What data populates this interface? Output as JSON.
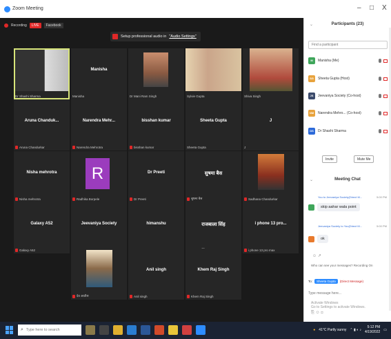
{
  "window": {
    "title": "Zoom Meeting",
    "minimize": "–",
    "maximize": "□",
    "close": "X"
  },
  "recording": {
    "label": "Recording",
    "live": "LIVE",
    "platform": "Facebook"
  },
  "audio_tip": {
    "text": "Setup professional audio in ",
    "link": "\"Audio Settings\""
  },
  "tiles": [
    {
      "label": "Dr Shashi Sharma",
      "mute": false
    },
    {
      "name": "Manisha",
      "label": "Manisha",
      "mute": false
    },
    {
      "label": "Dr Mani Ram Singh",
      "mute": false
    },
    {
      "label": "Sylvie Gupta",
      "mute": false
    },
    {
      "label": "Shiva Singh",
      "mute": false
    },
    {
      "name": "Aruna Chanduk...",
      "label": "Aruna Chandurkar",
      "mute": true
    },
    {
      "name": "Narendra Mehr...",
      "label": "Narendra Mehrotra",
      "mute": true
    },
    {
      "name": "bisshan kumar",
      "label": "bisshan kumar",
      "mute": true
    },
    {
      "name": "Sheeta Gupta",
      "label": "Sheeta Gupta",
      "mute": false
    },
    {
      "name": "J",
      "label": "J",
      "mute": false
    },
    {
      "name": "Nisha mehrotra",
      "label": "Nisha mehrotra",
      "mute": true
    },
    {
      "label": "Radhika Borpele",
      "avatar": "R",
      "mute": true
    },
    {
      "name": "Dr Preeti",
      "label": "Dr Preeti",
      "mute": true
    },
    {
      "name": "सुषमा बैस",
      "label": "सुषमा बैस",
      "mute": true
    },
    {
      "label": "Sadhana Chandurkar",
      "mute": true
    },
    {
      "name": "Galaxy A52",
      "label": "Galaxy A52",
      "mute": true
    },
    {
      "name": "Jeevaniya Society",
      "label": "Jeevaniya Society",
      "mute": true
    },
    {
      "name": "himanshu",
      "label": "himanshu",
      "mute": true
    },
    {
      "name": "राजबाला सिंह",
      "label": "राजबाला सिंह",
      "mute": true
    },
    {
      "name": "i phone 13 pro...",
      "label": "i phone 13 pro max",
      "mute": true
    },
    {
      "label": "देव आतीश",
      "mute": true
    },
    {
      "name": "Anil singh",
      "label": "Anil singh",
      "mute": true
    },
    {
      "name": "Khem Raj Singh",
      "label": "Khem Raj Singh",
      "mute": true
    }
  ],
  "participants": {
    "title": "Participants (23)",
    "search_placeholder": "Find a participant",
    "items": [
      {
        "name": "Manisha (Me)",
        "initials": "M",
        "color": "#3fa65b"
      },
      {
        "name": "Sheeta Gupta (Host)",
        "initials": "SG",
        "color": "#e8a33d"
      },
      {
        "name": "Jeevaniya Society (Co-host)",
        "initials": "JS",
        "color": "#3b4a6b"
      },
      {
        "name": "Narendra Mehro... (Co-host)",
        "initials": "NM",
        "color": "#e8a33d"
      },
      {
        "name": "Dr Shashi Sharma",
        "initials": "DS",
        "color": "#2d6ad9"
      }
    ],
    "invite": "Invite",
    "mute_me": "Mute Me"
  },
  "chat": {
    "title": "Meeting Chat",
    "messages": [
      {
        "meta": "You to Jeevaniya Society(Direct M...",
        "time": "5:00 PM",
        "text": "skip aahar wala point",
        "color": "#3fa65b"
      },
      {
        "meta": "Jeevaniya Society to You(Direct M...",
        "time": "5:00 PM",
        "text": "ok",
        "color": "#e87a2d"
      }
    ],
    "note": "Who can see your messages? Recording On",
    "to_label": "To:",
    "to_value": "Sheeta Gupta",
    "to_type": "(Direct Message)",
    "input_placeholder": "Type message here...",
    "watermark_1": "Activate Windows",
    "watermark_2": "Go to Settings to activate Windows."
  },
  "taskbar": {
    "search_placeholder": "Type here to search",
    "weather": "41°C Partly sunny",
    "time": "5:12 PM",
    "date": "4/19/2022"
  }
}
